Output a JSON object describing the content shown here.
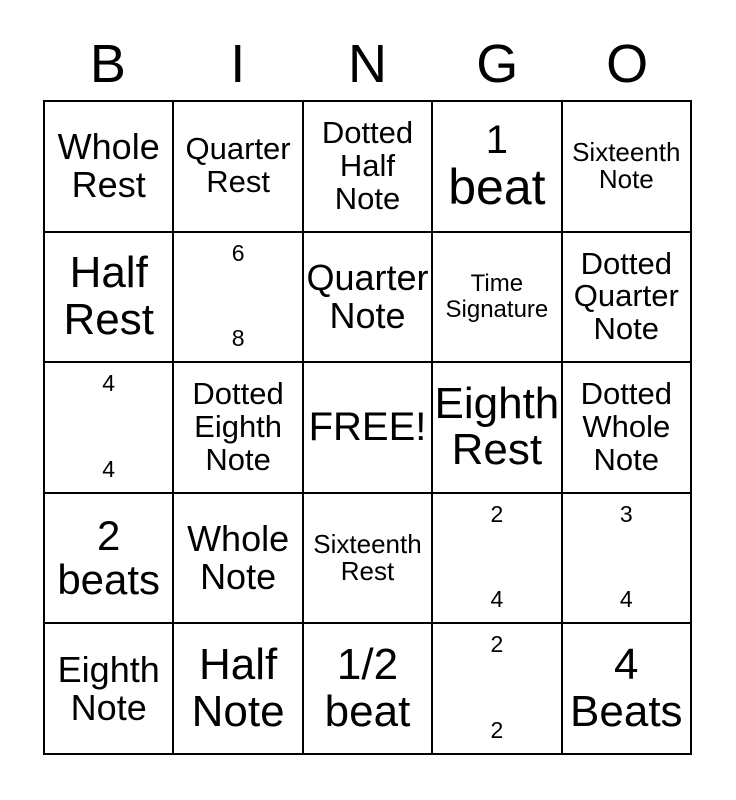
{
  "card": {
    "title_letters": [
      "B",
      "I",
      "N",
      "G",
      "O"
    ],
    "free_space_label": "FREE!",
    "colors": {
      "background": "#ffffff",
      "text": "#000000",
      "border": "#000000"
    }
  },
  "grid": {
    "rows": 5,
    "columns": 5,
    "cells": [
      [
        {
          "kind": "words",
          "lines": [
            "Whole",
            "Rest"
          ],
          "text": "Whole Rest"
        },
        {
          "kind": "words",
          "lines": [
            "Quarter",
            "Rest"
          ],
          "text": "Quarter Rest"
        },
        {
          "kind": "words",
          "lines": [
            "Dotted",
            "Half",
            "Note"
          ],
          "text": "Dotted Half Note"
        },
        {
          "kind": "words",
          "lines": [
            "1",
            "beat"
          ],
          "text": "1 beat"
        },
        {
          "kind": "words",
          "lines": [
            "Sixteenth",
            "Note"
          ],
          "text": "Sixteenth Note"
        }
      ],
      [
        {
          "kind": "words",
          "lines": [
            "Half",
            "Rest"
          ],
          "text": "Half Rest"
        },
        {
          "kind": "timesig",
          "numerator": "6",
          "denominator": "8",
          "text": "6/8"
        },
        {
          "kind": "words",
          "lines": [
            "Quarter",
            "Note"
          ],
          "text": "Quarter Note"
        },
        {
          "kind": "words",
          "lines": [
            "Time",
            "Signature"
          ],
          "text": "Time Signature"
        },
        {
          "kind": "words",
          "lines": [
            "Dotted",
            "Quarter",
            "Note"
          ],
          "text": "Dotted Quarter Note"
        }
      ],
      [
        {
          "kind": "timesig",
          "numerator": "4",
          "denominator": "4",
          "text": "4/4"
        },
        {
          "kind": "words",
          "lines": [
            "Dotted",
            "Eighth",
            "Note"
          ],
          "text": "Dotted Eighth Note"
        },
        {
          "kind": "words",
          "lines": [
            "FREE!"
          ],
          "text": "FREE!"
        },
        {
          "kind": "words",
          "lines": [
            "Eighth",
            "Rest"
          ],
          "text": "Eighth Rest"
        },
        {
          "kind": "words",
          "lines": [
            "Dotted",
            "Whole",
            "Note"
          ],
          "text": "Dotted Whole Note"
        }
      ],
      [
        {
          "kind": "words",
          "lines": [
            "2",
            "beats"
          ],
          "text": "2 beats"
        },
        {
          "kind": "words",
          "lines": [
            "Whole",
            "Note"
          ],
          "text": "Whole Note"
        },
        {
          "kind": "words",
          "lines": [
            "Sixteenth",
            "Rest"
          ],
          "text": "Sixteenth Rest"
        },
        {
          "kind": "timesig",
          "numerator": "2",
          "denominator": "4",
          "text": "2/4"
        },
        {
          "kind": "timesig",
          "numerator": "3",
          "denominator": "4",
          "text": "3/4"
        }
      ],
      [
        {
          "kind": "words",
          "lines": [
            "Eighth",
            "Note"
          ],
          "text": "Eighth Note"
        },
        {
          "kind": "words",
          "lines": [
            "Half",
            "Note"
          ],
          "text": "Half Note"
        },
        {
          "kind": "words",
          "lines": [
            "1/2",
            "beat"
          ],
          "text": "1/2 beat"
        },
        {
          "kind": "timesig",
          "numerator": "2",
          "denominator": "2",
          "text": "2/2"
        },
        {
          "kind": "words",
          "lines": [
            "4",
            "Beats"
          ],
          "text": "4 Beats"
        }
      ]
    ]
  }
}
